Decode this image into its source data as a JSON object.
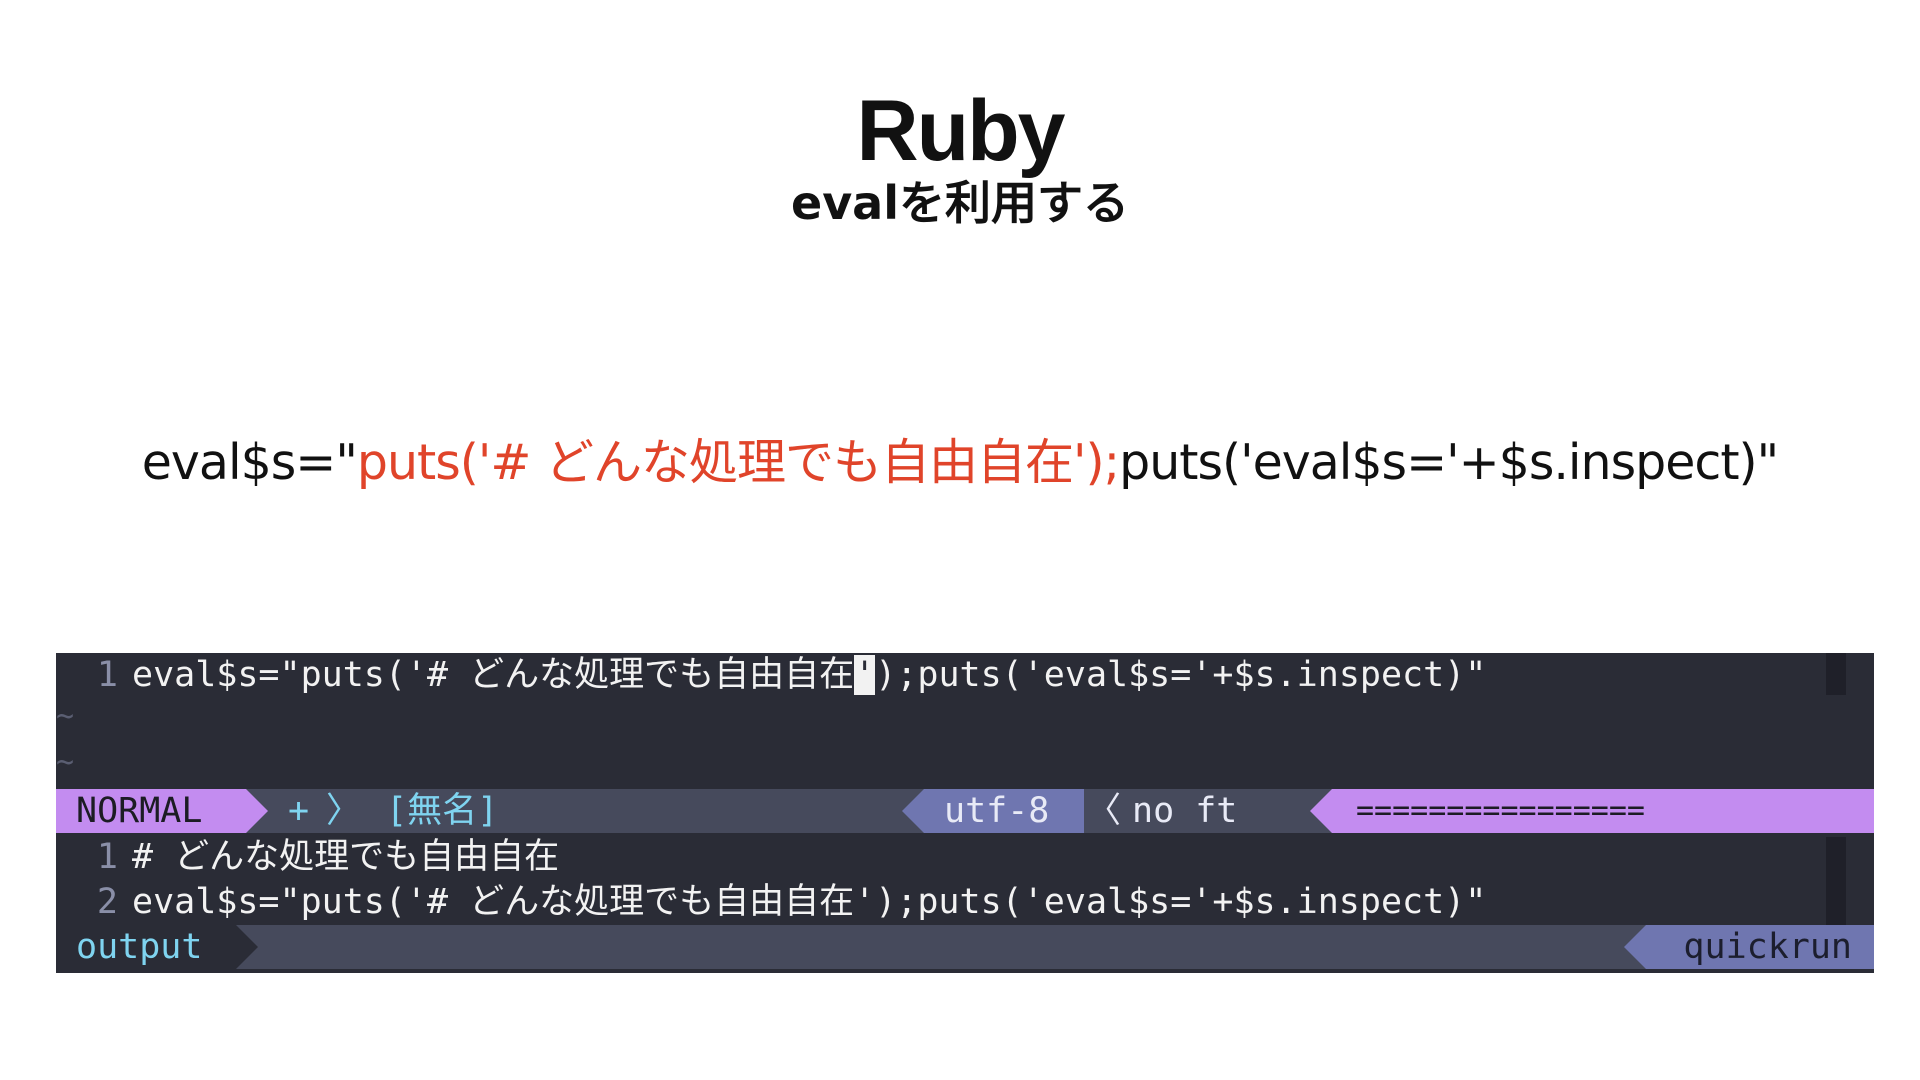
{
  "slide": {
    "title": "Ruby",
    "subtitle": "evalを利用する",
    "code": {
      "prefix": "eval$s=\"",
      "highlight": "puts('# どんな処理でも自由自在');",
      "suffix": "puts('eval$s='+$s.inspect)\""
    }
  },
  "editor": {
    "buffer": {
      "line_number": "1",
      "text_before_cursor": "eval$s=\"puts('# どんな処理でも自由自在",
      "cursor_char": "'",
      "text_after_cursor": ");puts('eval$s='+$s.inspect)\"",
      "tilde": "~"
    },
    "statusline": {
      "mode": "NORMAL",
      "modified": "+",
      "filename": "[無名]",
      "encoding": "utf-8",
      "filetype": "no ft",
      "progress": "================"
    },
    "output": {
      "lines": [
        {
          "num": "1",
          "text": "# どんな処理でも自由自在"
        },
        {
          "num": "2",
          "text": "eval$s=\"puts('# どんな処理でも自由自在');puts('eval$s='+$s.inspect)\""
        }
      ]
    },
    "output_statusline": {
      "label": "output",
      "runner": "quickrun"
    }
  },
  "colors": {
    "highlight": "#e0442a",
    "terminal_bg": "#2a2c36",
    "mode_bg": "#c38cf0",
    "statusline_bg": "#464a5c",
    "quickrun_bg": "#6f76b0"
  }
}
